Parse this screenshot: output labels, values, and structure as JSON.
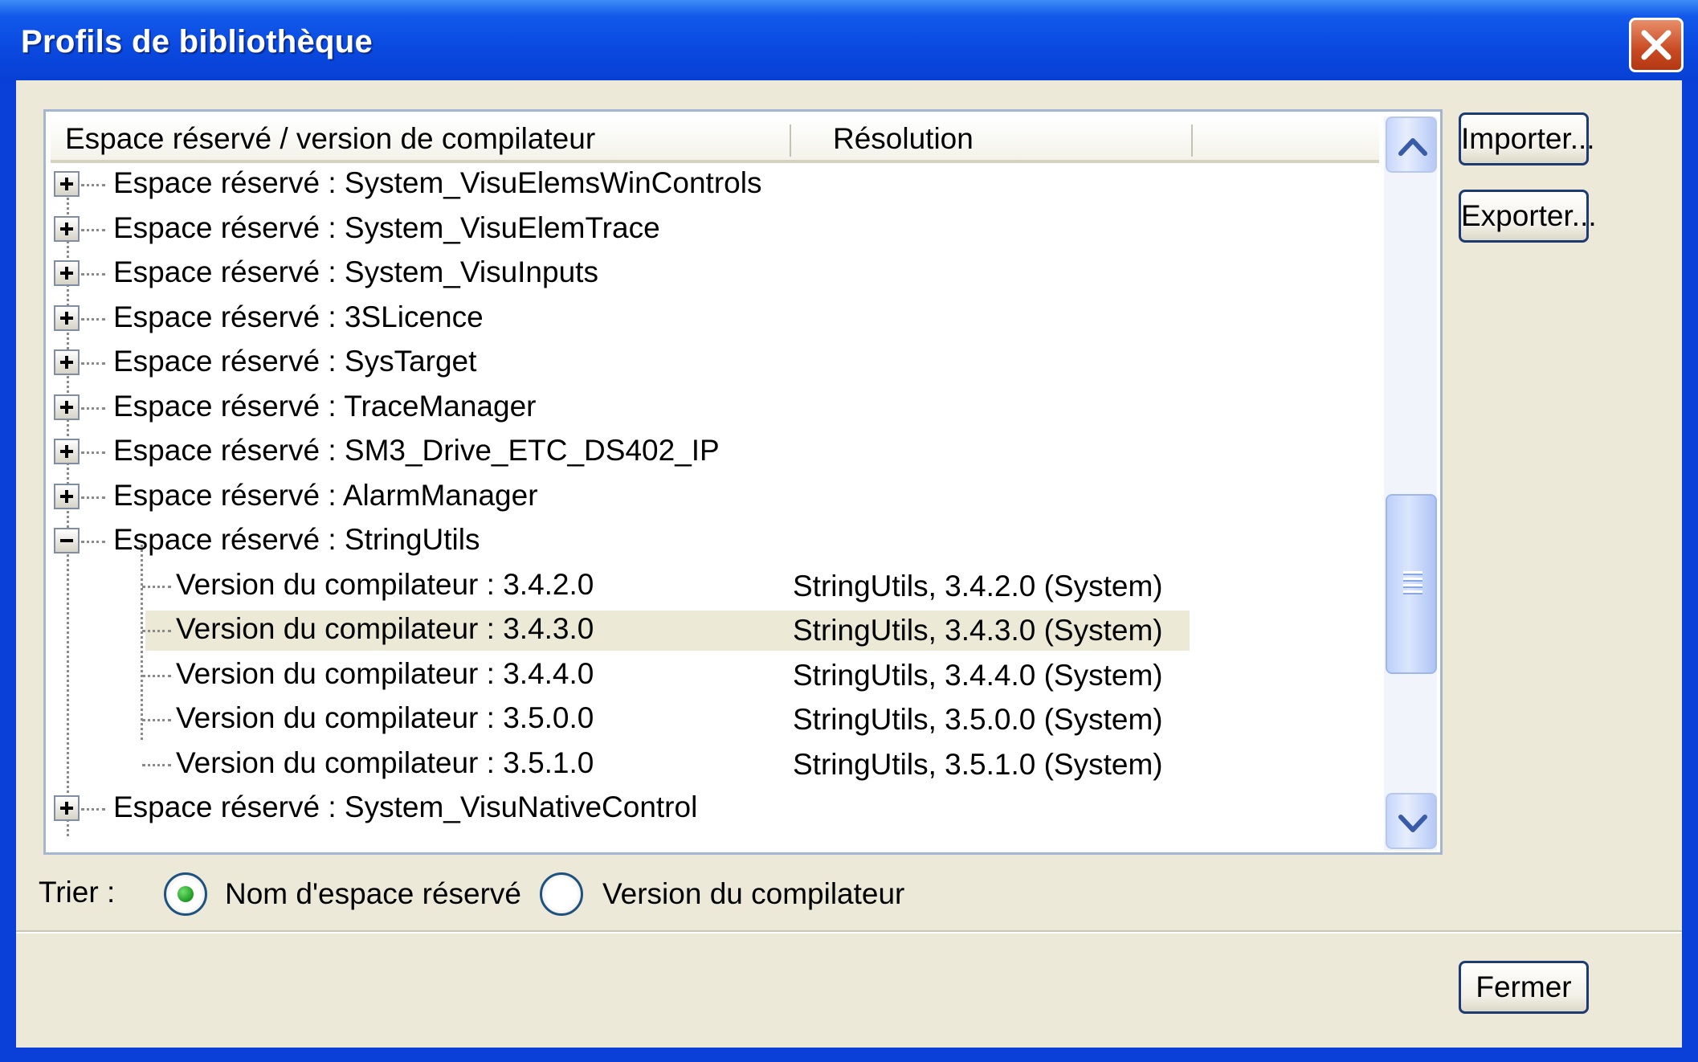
{
  "window": {
    "title": "Profils de bibliothèque",
    "close_icon": "close-icon"
  },
  "tree": {
    "columns": [
      "Espace réservé / version de compilateur",
      "Résolution"
    ],
    "rows": [
      {
        "label": "Espace réservé : System_VisuElemsWinControls",
        "resolution": "",
        "level": 1,
        "expander": "plus"
      },
      {
        "label": "Espace réservé : System_VisuElemTrace",
        "resolution": "",
        "level": 1,
        "expander": "plus"
      },
      {
        "label": "Espace réservé : System_VisuInputs",
        "resolution": "",
        "level": 1,
        "expander": "plus"
      },
      {
        "label": "Espace réservé : 3SLicence",
        "resolution": "",
        "level": 1,
        "expander": "plus"
      },
      {
        "label": "Espace réservé : SysTarget",
        "resolution": "",
        "level": 1,
        "expander": "plus"
      },
      {
        "label": "Espace réservé : TraceManager",
        "resolution": "",
        "level": 1,
        "expander": "plus"
      },
      {
        "label": "Espace réservé : SM3_Drive_ETC_DS402_IP",
        "resolution": "",
        "level": 1,
        "expander": "plus"
      },
      {
        "label": "Espace réservé : AlarmManager",
        "resolution": "",
        "level": 1,
        "expander": "plus"
      },
      {
        "label": "Espace réservé : StringUtils",
        "resolution": "",
        "level": 1,
        "expander": "minus"
      },
      {
        "label": "Version du compilateur : 3.4.2.0",
        "resolution": "StringUtils, 3.4.2.0 (System)",
        "level": 2
      },
      {
        "label": "Version du compilateur : 3.4.3.0",
        "resolution": "StringUtils, 3.4.3.0 (System)",
        "level": 2,
        "selected": true
      },
      {
        "label": "Version du compilateur : 3.4.4.0",
        "resolution": "StringUtils, 3.4.4.0 (System)",
        "level": 2
      },
      {
        "label": "Version du compilateur : 3.5.0.0",
        "resolution": "StringUtils, 3.5.0.0 (System)",
        "level": 2
      },
      {
        "label": "Version du compilateur : 3.5.1.0",
        "resolution": "StringUtils, 3.5.1.0 (System)",
        "level": 2
      },
      {
        "label": "Espace réservé : System_VisuNativeControl",
        "resolution": "",
        "level": 1,
        "expander": "plus"
      }
    ]
  },
  "buttons": {
    "import": "Importer...",
    "export": "Exporter...",
    "close": "Fermer"
  },
  "sort": {
    "label": "Trier :",
    "options": [
      {
        "label": "Nom d'espace réservé",
        "checked": true
      },
      {
        "label": "Version du compilateur",
        "checked": false
      }
    ]
  },
  "colors": {
    "title_bar": "#0a49e0",
    "dialog_bg": "#ece9d8",
    "selection": "#ece9d6",
    "radio_checked": "#1f9a1f"
  }
}
